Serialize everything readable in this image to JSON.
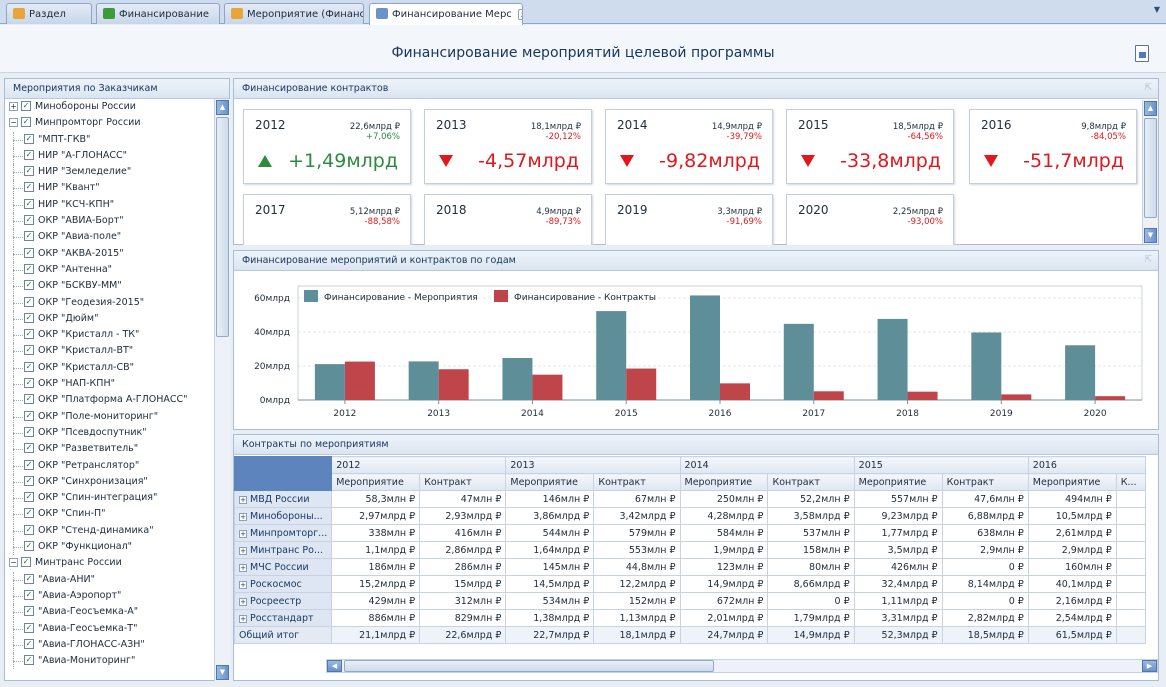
{
  "tabs": [
    {
      "label": "Раздел",
      "icon": "folder-icon",
      "active": false
    },
    {
      "label": "Финансирование",
      "icon": "dollar-icon",
      "active": false
    },
    {
      "label": "Мероприятие (Финанс",
      "icon": "folder-icon",
      "active": false
    },
    {
      "label": "Финансирование Мерс",
      "icon": "chart-icon",
      "active": true
    }
  ],
  "page_title": "Финансирование мероприятий целевой программы",
  "left_panel": {
    "title": "Мероприятия по Заказчикам",
    "tree": [
      {
        "label": "Минобороны России",
        "level": 0,
        "expanded": false
      },
      {
        "label": "Минпромторг России",
        "level": 0,
        "expanded": true
      },
      {
        "label": "\"МПТ-ГКВ\"",
        "level": 1
      },
      {
        "label": "НИР \"А-ГЛОНАСС\"",
        "level": 1
      },
      {
        "label": "НИР \"Земледелие\"",
        "level": 1
      },
      {
        "label": "НИР \"Квант\"",
        "level": 1
      },
      {
        "label": "НИР \"КСЧ-КПН\"",
        "level": 1
      },
      {
        "label": "ОКР \"АВИА-Борт\"",
        "level": 1
      },
      {
        "label": "ОКР \"Авиа-поле\"",
        "level": 1
      },
      {
        "label": "ОКР \"АКВА-2015\"",
        "level": 1
      },
      {
        "label": "ОКР \"Антенна\"",
        "level": 1
      },
      {
        "label": "ОКР \"БСКВУ-ММ\"",
        "level": 1
      },
      {
        "label": "ОКР \"Геодезия-2015\"",
        "level": 1
      },
      {
        "label": "ОКР \"Дюйм\"",
        "level": 1
      },
      {
        "label": "ОКР \"Кристалл - ТК\"",
        "level": 1
      },
      {
        "label": "ОКР \"Кристалл-ВТ\"",
        "level": 1
      },
      {
        "label": "ОКР \"Кристалл-СВ\"",
        "level": 1
      },
      {
        "label": "ОКР \"НАП-КПН\"",
        "level": 1
      },
      {
        "label": "ОКР \"Платформа А-ГЛОНАСС\"",
        "level": 1
      },
      {
        "label": "ОКР \"Поле-мониторинг\"",
        "level": 1
      },
      {
        "label": "ОКР \"Псевдоспутник\"",
        "level": 1
      },
      {
        "label": "ОКР \"Разветвитель\"",
        "level": 1
      },
      {
        "label": "ОКР \"Ретранслятор\"",
        "level": 1
      },
      {
        "label": "ОКР \"Синхронизация\"",
        "level": 1
      },
      {
        "label": "ОКР \"Спин-интеграция\"",
        "level": 1
      },
      {
        "label": "ОКР \"Спин-П\"",
        "level": 1
      },
      {
        "label": "ОКР \"Стенд-динамика\"",
        "level": 1
      },
      {
        "label": "ОКР \"Функционал\"",
        "level": 1
      },
      {
        "label": "Минтранс России",
        "level": 0,
        "expanded": true
      },
      {
        "label": "\"Авиа-АНИ\"",
        "level": 1
      },
      {
        "label": "\"Авиа-Аэропорт\"",
        "level": 1
      },
      {
        "label": "\"Авиа-Геосъемка-А\"",
        "level": 1
      },
      {
        "label": "\"Авиа-Геосъемка-Т\"",
        "level": 1
      },
      {
        "label": "\"Авиа-ГЛОНАСС-АЗН\"",
        "level": 1
      },
      {
        "label": "\"Авиа-Мониторинг\"",
        "level": 1
      }
    ]
  },
  "contracts_panel": {
    "title": "Финансирование контрактов",
    "cards": [
      {
        "year": "2012",
        "amount": "22,6млрд ₽",
        "pct": "+7,06%",
        "delta": "+1,49млрд",
        "dir": "up"
      },
      {
        "year": "2013",
        "amount": "18,1млрд ₽",
        "pct": "-20,12%",
        "delta": "-4,57млрд",
        "dir": "down"
      },
      {
        "year": "2014",
        "amount": "14,9млрд ₽",
        "pct": "-39,79%",
        "delta": "-9,82млрд",
        "dir": "down"
      },
      {
        "year": "2015",
        "amount": "18,5млрд ₽",
        "pct": "-64,56%",
        "delta": "-33,8млрд",
        "dir": "down"
      },
      {
        "year": "2016",
        "amount": "9,8млрд ₽",
        "pct": "-84,05%",
        "delta": "-51,7млрд",
        "dir": "down"
      },
      {
        "year": "2017",
        "amount": "5,12млрд ₽",
        "pct": "-88,58%"
      },
      {
        "year": "2018",
        "amount": "4,9млрд ₽",
        "pct": "-89,73%"
      },
      {
        "year": "2019",
        "amount": "3,3млрд ₽",
        "pct": "-91,69%"
      },
      {
        "year": "2020",
        "amount": "2,25млрд ₽",
        "pct": "-93,00%"
      }
    ]
  },
  "chart_panel": {
    "title": "Финансирование мероприятий и контрактов по годам"
  },
  "chart_data": {
    "type": "bar",
    "categories": [
      "2012",
      "2013",
      "2014",
      "2015",
      "2016",
      "2017",
      "2018",
      "2019",
      "2020"
    ],
    "series": [
      {
        "name": "Финансирование - Мероприятия",
        "color": "#5e8e98",
        "values": [
          21.1,
          22.7,
          24.7,
          52.3,
          61.5,
          44.8,
          47.7,
          39.7,
          32.2
        ]
      },
      {
        "name": "Финансирование - Контракты",
        "color": "#c0454a",
        "values": [
          22.6,
          18.1,
          14.9,
          18.5,
          9.8,
          5.12,
          4.9,
          3.3,
          2.25
        ]
      }
    ],
    "y_ticks": [
      "0млрд",
      "20млрд",
      "40млрд",
      "60млрд"
    ],
    "ylim": [
      0,
      65
    ],
    "legend": "top-left",
    "grid": true
  },
  "grid_panel": {
    "title": "Контракты по мероприятиям",
    "years": [
      "2012",
      "2013",
      "2014",
      "2015",
      "2016"
    ],
    "sub_event": "Мероприятие",
    "sub_contract": "Контракт",
    "sub_cut": "К...",
    "rows": [
      {
        "name": "МВД России",
        "vals": [
          "58,3млн ₽",
          "47млн ₽",
          "146млн ₽",
          "67млн ₽",
          "250млн ₽",
          "52,2млн ₽",
          "557млн ₽",
          "47,6млн ₽",
          "494млн ₽"
        ]
      },
      {
        "name": "Минобороны...",
        "vals": [
          "2,97млрд ₽",
          "2,93млрд ₽",
          "3,86млрд ₽",
          "3,42млрд ₽",
          "4,28млрд ₽",
          "3,58млрд ₽",
          "9,23млрд ₽",
          "6,88млрд ₽",
          "10,5млрд ₽"
        ]
      },
      {
        "name": "Минпромторг...",
        "vals": [
          "338млн ₽",
          "416млн ₽",
          "544млн ₽",
          "579млн ₽",
          "584млн ₽",
          "537млн ₽",
          "1,77млрд ₽",
          "638млн ₽",
          "2,61млрд ₽"
        ]
      },
      {
        "name": "Минтранс Ро...",
        "vals": [
          "1,1млрд ₽",
          "2,86млрд ₽",
          "1,64млрд ₽",
          "553млн ₽",
          "1,9млрд ₽",
          "158млн ₽",
          "3,5млрд ₽",
          "2,9млн ₽",
          "2,9млрд ₽"
        ]
      },
      {
        "name": "МЧС России",
        "vals": [
          "186млн ₽",
          "286млн ₽",
          "145млн ₽",
          "44,8млн ₽",
          "123млн ₽",
          "80млн ₽",
          "426млн ₽",
          "0 ₽",
          "160млн ₽"
        ]
      },
      {
        "name": "Роскосмос",
        "vals": [
          "15,2млрд ₽",
          "15млрд ₽",
          "14,5млрд ₽",
          "12,2млрд ₽",
          "14,9млрд ₽",
          "8,66млрд ₽",
          "32,4млрд ₽",
          "8,14млрд ₽",
          "40,1млрд ₽"
        ]
      },
      {
        "name": "Росреестр",
        "vals": [
          "429млн ₽",
          "312млн ₽",
          "534млн ₽",
          "152млн ₽",
          "672млн ₽",
          "0 ₽",
          "1,11млрд ₽",
          "0 ₽",
          "2,16млрд ₽"
        ]
      },
      {
        "name": "Росстандарт",
        "vals": [
          "886млн ₽",
          "829млн ₽",
          "1,38млрд ₽",
          "1,13млрд ₽",
          "2,01млрд ₽",
          "1,79млрд ₽",
          "3,31млрд ₽",
          "2,82млрд ₽",
          "2,54млрд ₽"
        ]
      }
    ],
    "total": {
      "name": "Общий итог",
      "vals": [
        "21,1млрд ₽",
        "22,6млрд ₽",
        "22,7млрд ₽",
        "18,1млрд ₽",
        "24,7млрд ₽",
        "14,9млрд ₽",
        "52,3млрд ₽",
        "18,5млрд ₽",
        "61,5млрд ₽"
      ]
    }
  }
}
